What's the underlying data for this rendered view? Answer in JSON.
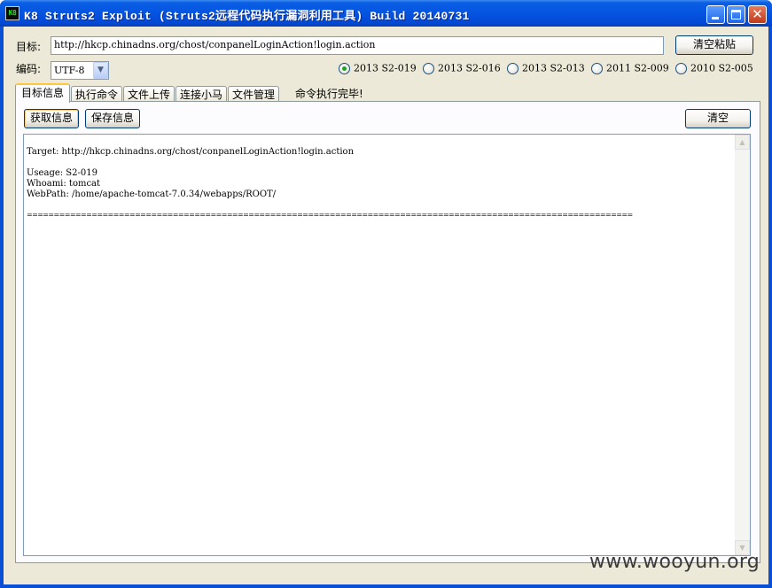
{
  "window": {
    "title": "K8 Struts2 Exploit (Struts2远程代码执行漏洞利用工具)  Build 20140731",
    "icon_text": "K8",
    "controls": {
      "minimize_icon": "minimize-icon",
      "maximize_icon": "maximize-icon",
      "close_icon": "close-icon",
      "close_glyph": "✕"
    }
  },
  "target": {
    "label": "目标:",
    "value": "http://hkcp.chinadns.org/chost/conpanelLoginAction!login.action"
  },
  "clear_paste_button": "清空粘贴",
  "encoding": {
    "label": "编码:",
    "value": "UTF-8",
    "arrow": "▼"
  },
  "exploit_options": [
    {
      "label": "2013 S2-019",
      "checked": true
    },
    {
      "label": "2013 S2-016",
      "checked": false
    },
    {
      "label": "2013 S2-013",
      "checked": false
    },
    {
      "label": "2011 S2-009",
      "checked": false
    },
    {
      "label": "2010 S2-005",
      "checked": false
    }
  ],
  "tabs": [
    {
      "label": "目标信息",
      "active": true
    },
    {
      "label": "执行命令",
      "active": false
    },
    {
      "label": "文件上传",
      "active": false
    },
    {
      "label": "连接小马",
      "active": false
    },
    {
      "label": "文件管理",
      "active": false
    }
  ],
  "status_text": "命令执行完毕!",
  "panel": {
    "get_info_button": "获取信息",
    "save_info_button": "保存信息",
    "clear_button": "清空",
    "output_lines": [
      "Target: http://hkcp.chinadns.org/chost/conpanelLoginAction!login.action",
      "Useage: S2-019",
      "Whoami: tomcat",
      "WebPath: /home/apache-tomcat-7.0.34/webapps/ROOT/",
      "================================================================================================================"
    ],
    "scroll_up": "▲",
    "scroll_down": "▼"
  },
  "watermark": "www.wooyun.org",
  "colors": {
    "titlebar": "#0554e0",
    "window_bg": "#ece9d8",
    "accent_tab": "#ffc83c",
    "radio_checked": "#21a121"
  }
}
